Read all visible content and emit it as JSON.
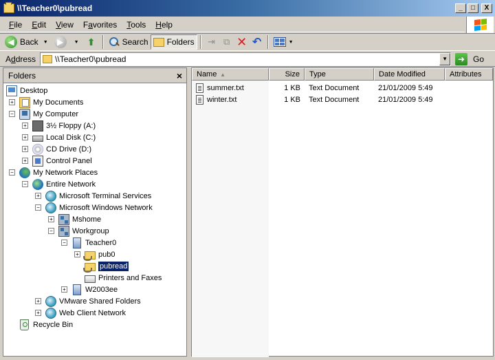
{
  "window": {
    "title": "\\\\Teacher0\\pubread",
    "buttons": {
      "minimize": "_",
      "maximize": "□",
      "close": "X"
    }
  },
  "menu": {
    "items": [
      {
        "first": "F",
        "rest": "ile"
      },
      {
        "first": "E",
        "rest": "dit"
      },
      {
        "first": "V",
        "rest": "iew"
      },
      {
        "first": "",
        "pre": "F",
        "rest": "avorites",
        "ul": "a"
      },
      {
        "first": "T",
        "rest": "ools"
      },
      {
        "first": "H",
        "rest": "elp"
      }
    ]
  },
  "toolbar": {
    "back_label": "Back",
    "search_label": "Search",
    "folders_label": "Folders"
  },
  "address": {
    "label_pre": "A",
    "label_ul": "d",
    "label_post": "dress",
    "value": "\\\\Teacher0\\pubread",
    "go_label": "Go"
  },
  "folders_pane": {
    "title": "Folders",
    "close": "×",
    "tree": [
      {
        "label": "Desktop",
        "icon": "desktop-icon",
        "depth": 0,
        "expander": ""
      },
      {
        "label": "My Documents",
        "icon": "my-documents-icon",
        "depth": 1,
        "expander": "+"
      },
      {
        "label": "My Computer",
        "icon": "computer-icon",
        "depth": 1,
        "expander": "−"
      },
      {
        "label": "3½ Floppy (A:)",
        "icon": "floppy-icon",
        "depth": 2,
        "expander": "+"
      },
      {
        "label": "Local Disk (C:)",
        "icon": "local-disk-icon",
        "depth": 2,
        "expander": "+"
      },
      {
        "label": "CD Drive (D:)",
        "icon": "cd-drive-icon",
        "depth": 2,
        "expander": "+"
      },
      {
        "label": "Control Panel",
        "icon": "control-panel-icon",
        "depth": 2,
        "expander": "+"
      },
      {
        "label": "My Network Places",
        "icon": "network-places-icon",
        "depth": 1,
        "expander": "−"
      },
      {
        "label": "Entire Network",
        "icon": "entire-network-icon",
        "depth": 2,
        "expander": "−"
      },
      {
        "label": "Microsoft Terminal Services",
        "icon": "network-globe-icon",
        "depth": 3,
        "expander": "+"
      },
      {
        "label": "Microsoft Windows Network",
        "icon": "network-globe-icon",
        "depth": 3,
        "expander": "−"
      },
      {
        "label": "Mshome",
        "icon": "workgroup-icon",
        "depth": 4,
        "expander": "+"
      },
      {
        "label": "Workgroup",
        "icon": "workgroup-icon",
        "depth": 4,
        "expander": "−"
      },
      {
        "label": "Teacher0",
        "icon": "server-icon",
        "depth": 5,
        "expander": "−"
      },
      {
        "label": "pub0",
        "icon": "shared-folder-icon",
        "depth": 6,
        "expander": "+"
      },
      {
        "label": "pubread",
        "icon": "shared-folder-icon",
        "depth": 6,
        "expander": "",
        "selected": true
      },
      {
        "label": "Printers and Faxes",
        "icon": "printer-icon",
        "depth": 6,
        "expander": ""
      },
      {
        "label": "W2003ee",
        "icon": "server-icon",
        "depth": 5,
        "expander": "+"
      },
      {
        "label": "VMware Shared Folders",
        "icon": "network-globe-icon",
        "depth": 3,
        "expander": "+"
      },
      {
        "label": "Web Client Network",
        "icon": "network-globe-icon",
        "depth": 3,
        "expander": "+"
      },
      {
        "label": "Recycle Bin",
        "icon": "recycle-bin-icon",
        "depth": 1,
        "expander": ""
      }
    ]
  },
  "file_list": {
    "columns": [
      "Name",
      "Size",
      "Type",
      "Date Modified",
      "Attributes"
    ],
    "rows": [
      {
        "name": "summer.txt",
        "size": "1 KB",
        "type": "Text Document",
        "modified": "21/01/2009 5:49"
      },
      {
        "name": "winter.txt",
        "size": "1 KB",
        "type": "Text Document",
        "modified": "21/01/2009 5:49"
      }
    ]
  }
}
